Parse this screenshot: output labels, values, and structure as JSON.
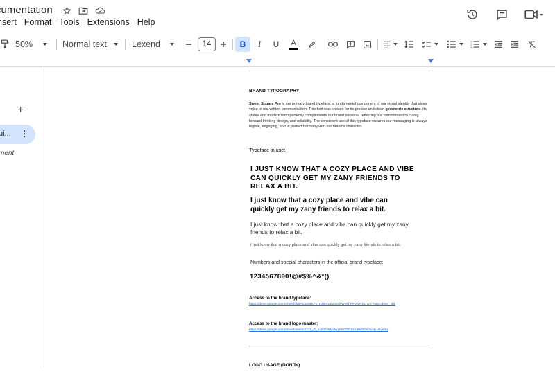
{
  "doc": {
    "title": "cumentation"
  },
  "menu": [
    "nsert",
    "Format",
    "Tools",
    "Extensions",
    "Help"
  ],
  "toolbar": {
    "zoom": "50%",
    "style": "Normal text",
    "font": "Lexend",
    "font_size": "14"
  },
  "outline": {
    "tab_label": "ui...",
    "comment_text": "ment"
  },
  "page": {
    "heading_brand": "BRAND TYPOGRAPHY",
    "intro_bold": "Sweet Square Pro",
    "intro_a": " is our primary brand typeface, a fundamental component of our visual identity that gives voice to our written communication. This font was chosen for its precise and clean ",
    "intro_bold2": "geometric structure",
    "intro_b": ". Its stable and modern form perfectly complements our brand persona, reflecting our commitment to clarity, forward-thinking design, and reliability. The consistent use of this typeface ensures our messaging is always legible, engaging, and in perfect harmony with our brand's character.",
    "typeface_label": "Typeface in use:",
    "sample_caps": "I just know that a cozy place and vibe can quickly get my zany friends to relax a bit.",
    "sample_bold": "I just know that a cozy place and vibe can quickly get my zany friends to relax a bit.",
    "sample_regular": "I just know that a cozy place and vibe can quickly get my zany friends to relax a bit.",
    "sample_light": "I just know that a cozy place and vibe can quickly get my zany friends to relax a bit.",
    "numbers_label": "Numbers and special characters in the official brand typeface:",
    "digits": "1234567890!@#$%^&*()",
    "access_typeface": "Access to the brand typeface:",
    "link_typeface": "https://drive.google.com/drive/folders/1mBK7oTNkkoD0hzxcohWe5hFPVMPSUYcT?usp=drive_link",
    "access_logo": "Access to the brand logo master:",
    "link_logo": "https://drive.google.com/drive/folders/1Yr1_G_xqlid0v5MvKq4hNT6FYzm95M0W?usp=sharing",
    "logo_usage": "LOGO USAGE (DON'Ts)"
  },
  "icons": {
    "star": "star-icon",
    "move": "folder-move-icon",
    "cloud": "cloud-icon",
    "history": "history-icon",
    "comments": "comment-icon",
    "meet": "video-icon"
  },
  "colors": {
    "accent": "#1a73e8",
    "active_bg": "#d3e3fd",
    "ruler_marker": "#4a80f0"
  }
}
